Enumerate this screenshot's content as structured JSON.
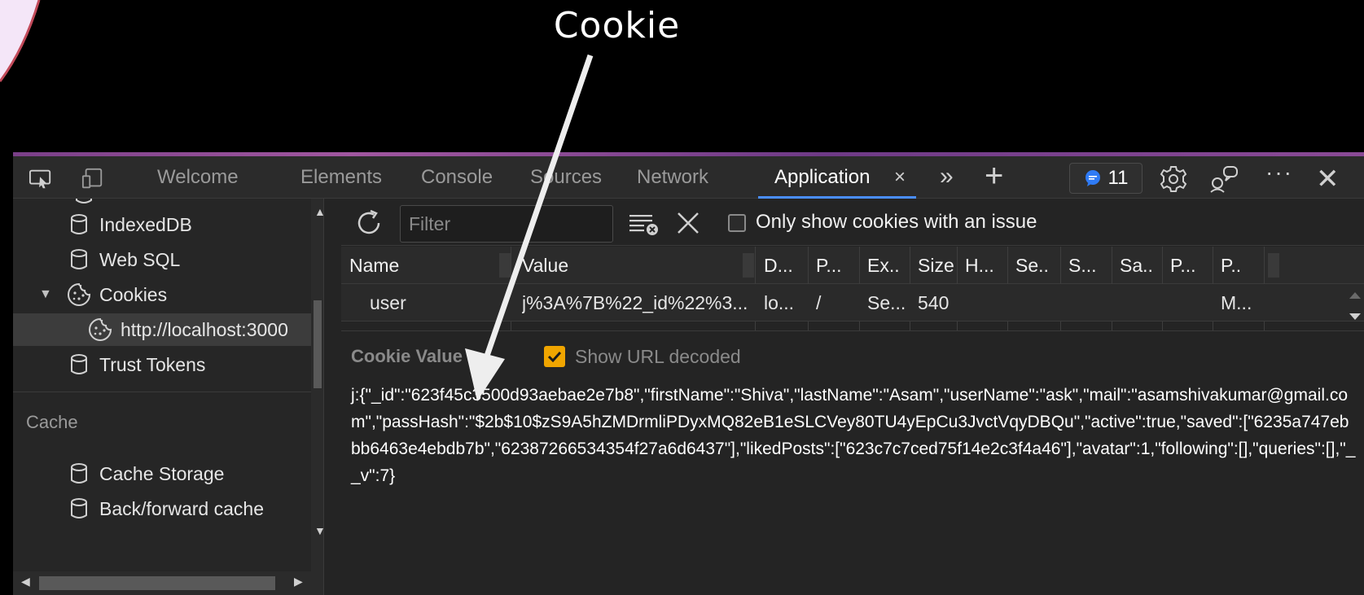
{
  "annotation": {
    "label": "Cookie"
  },
  "tabs": {
    "welcome": "Welcome",
    "elements": "Elements",
    "console": "Console",
    "sources": "Sources",
    "network": "Network",
    "application": "Application",
    "close_symbol": "×",
    "more_symbol": "»",
    "new_symbol": "+",
    "issues_count": "11",
    "more_options_symbol": "···",
    "close_devtools_symbol": "✕"
  },
  "sidebar": {
    "items": [
      {
        "label": "IndexedDB",
        "icon": "database-icon"
      },
      {
        "label": "Web SQL",
        "icon": "database-icon"
      },
      {
        "label": "Cookies",
        "icon": "cookie-icon",
        "expanded": true
      },
      {
        "label": "http://localhost:3000",
        "icon": "cookie-icon",
        "selected": true
      },
      {
        "label": "Trust Tokens",
        "icon": "database-icon"
      }
    ],
    "cache_heading": "Cache",
    "cache_items": [
      {
        "label": "Cache Storage",
        "icon": "database-icon"
      },
      {
        "label": "Back/forward cache",
        "icon": "database-icon"
      }
    ]
  },
  "toolbar": {
    "filter_placeholder": "Filter",
    "only_issues_label": "Only show cookies with an issue"
  },
  "table": {
    "headers": [
      "Name",
      "Value",
      "D...",
      "P...",
      "Ex..",
      "Size",
      "H...",
      "Se..",
      "S...",
      "Sa..",
      "P...",
      "P.."
    ],
    "row": [
      "user",
      "j%3A%7B%22_id%22%3...",
      "lo...",
      "/",
      "Se...",
      "540",
      "",
      "",
      "",
      "",
      "",
      "M..."
    ]
  },
  "value_panel": {
    "title": "Cookie Value",
    "show_decoded_label": "Show URL decoded",
    "show_decoded_checked": true,
    "value": "j:{\"_id\":\"623f45c3500d93aebae2e7b8\",\"firstName\":\"Shiva\",\"lastName\":\"Asam\",\"userName\":\"ask\",\"mail\":\"asamshivakumar@gmail.com\",\"passHash\":\"$2b$10$zS9A5hZMDrmliPDyxMQ82eB1eSLCVey80TU4yEpCu3JvctVqyDBQu\",\"active\":true,\"saved\":[\"6235a747ebbb6463e4ebdb7b\",\"62387266534354f27a6d6437\"],\"likedPosts\":[\"623c7c7ced75f14e2c3f4a46\"],\"avatar\":1,\"following\":[],\"queries\":[],\"__v\":7}"
  },
  "colors": {
    "accent": "#4a8eff",
    "checkbox": "#f0a500",
    "badge": "#2f7bf5"
  }
}
